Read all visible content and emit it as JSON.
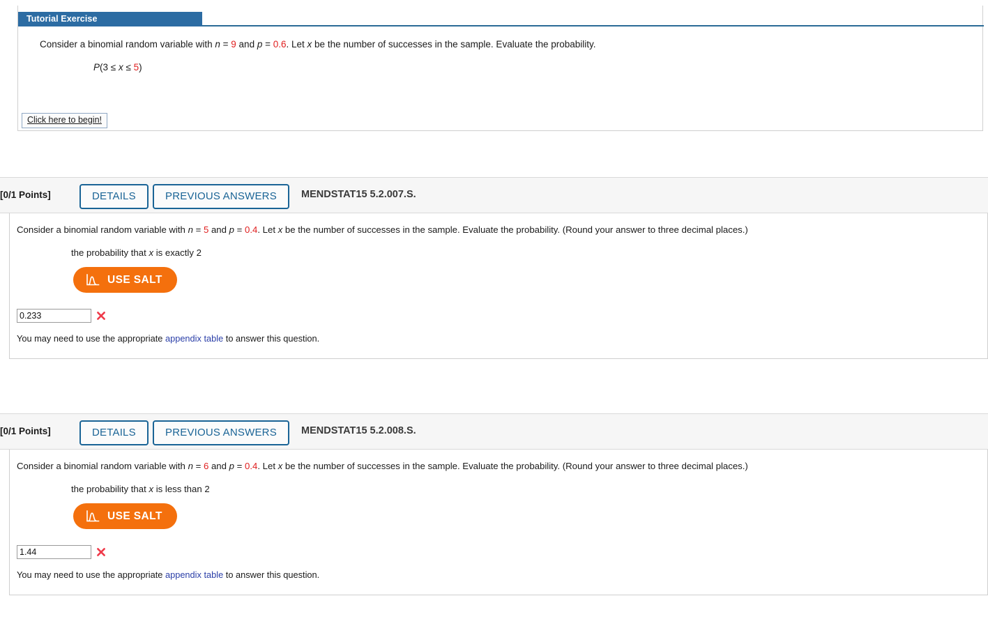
{
  "tutorial": {
    "tab_label": "Tutorial Exercise",
    "stem_prefix": "Consider a binomial random variable with ",
    "n_label": "n",
    "eq": " = ",
    "n_value": "9",
    "and": " and ",
    "p_label": "p",
    "p_value": "0.6",
    "stem_suffix": ". Let ",
    "x_label": "x",
    "stem_tail": " be the number of successes in the sample. Evaluate the probability.",
    "expr_p": "P",
    "expr_open": "(3 ≤ ",
    "expr_x": "x",
    "expr_mid": " ≤ ",
    "expr_upper": "5",
    "expr_close": ")",
    "begin_label": "Click here to begin!"
  },
  "questions": [
    {
      "points": "[0/1 Points]",
      "details_label": "DETAILS",
      "previous_answers_label": "PREVIOUS ANSWERS",
      "code": "MENDSTAT15 5.2.007.S.",
      "stem_prefix": "Consider a binomial random variable with ",
      "n_label": "n",
      "eq": " = ",
      "n_value": "5",
      "and": " and ",
      "p_label": "p",
      "p_value": "0.4",
      "stem_mid": ". Let ",
      "x_label": "x",
      "stem_tail": " be the number of successes in the sample. Evaluate the probability. (Round your answer to three decimal places.)",
      "sub_prefix": "the probability that ",
      "sub_x": "x",
      "sub_tail": " is exactly 2",
      "salt_label": "USE SALT",
      "answer_value": "0.233",
      "answer_status": "incorrect",
      "hint_prefix": "You may need to use the appropriate ",
      "hint_link": "appendix table",
      "hint_suffix": " to answer this question."
    },
    {
      "points": "[0/1 Points]",
      "details_label": "DETAILS",
      "previous_answers_label": "PREVIOUS ANSWERS",
      "code": "MENDSTAT15 5.2.008.S.",
      "stem_prefix": "Consider a binomial random variable with ",
      "n_label": "n",
      "eq": " = ",
      "n_value": "6",
      "and": " and ",
      "p_label": "p",
      "p_value": "0.4",
      "stem_mid": ". Let ",
      "x_label": "x",
      "stem_tail": " be the number of successes in the sample. Evaluate the probability. (Round your answer to three decimal places.)",
      "sub_prefix": "the probability that ",
      "sub_x": "x",
      "sub_tail": " is less than 2",
      "salt_label": "USE SALT",
      "answer_value": "1.44",
      "answer_status": "incorrect",
      "hint_prefix": "You may need to use the appropriate ",
      "hint_link": "appendix table",
      "hint_suffix": " to answer this question."
    }
  ],
  "colors": {
    "tab_blue": "#2c6ca3",
    "rule_blue": "#2a6b96",
    "button_blue": "#1a6496",
    "salt_orange": "#f4700d",
    "value_red": "#e02020",
    "link_blue": "#2b3fa8",
    "x_red": "#ef3a4a",
    "header_bg": "#f6f6f6"
  }
}
